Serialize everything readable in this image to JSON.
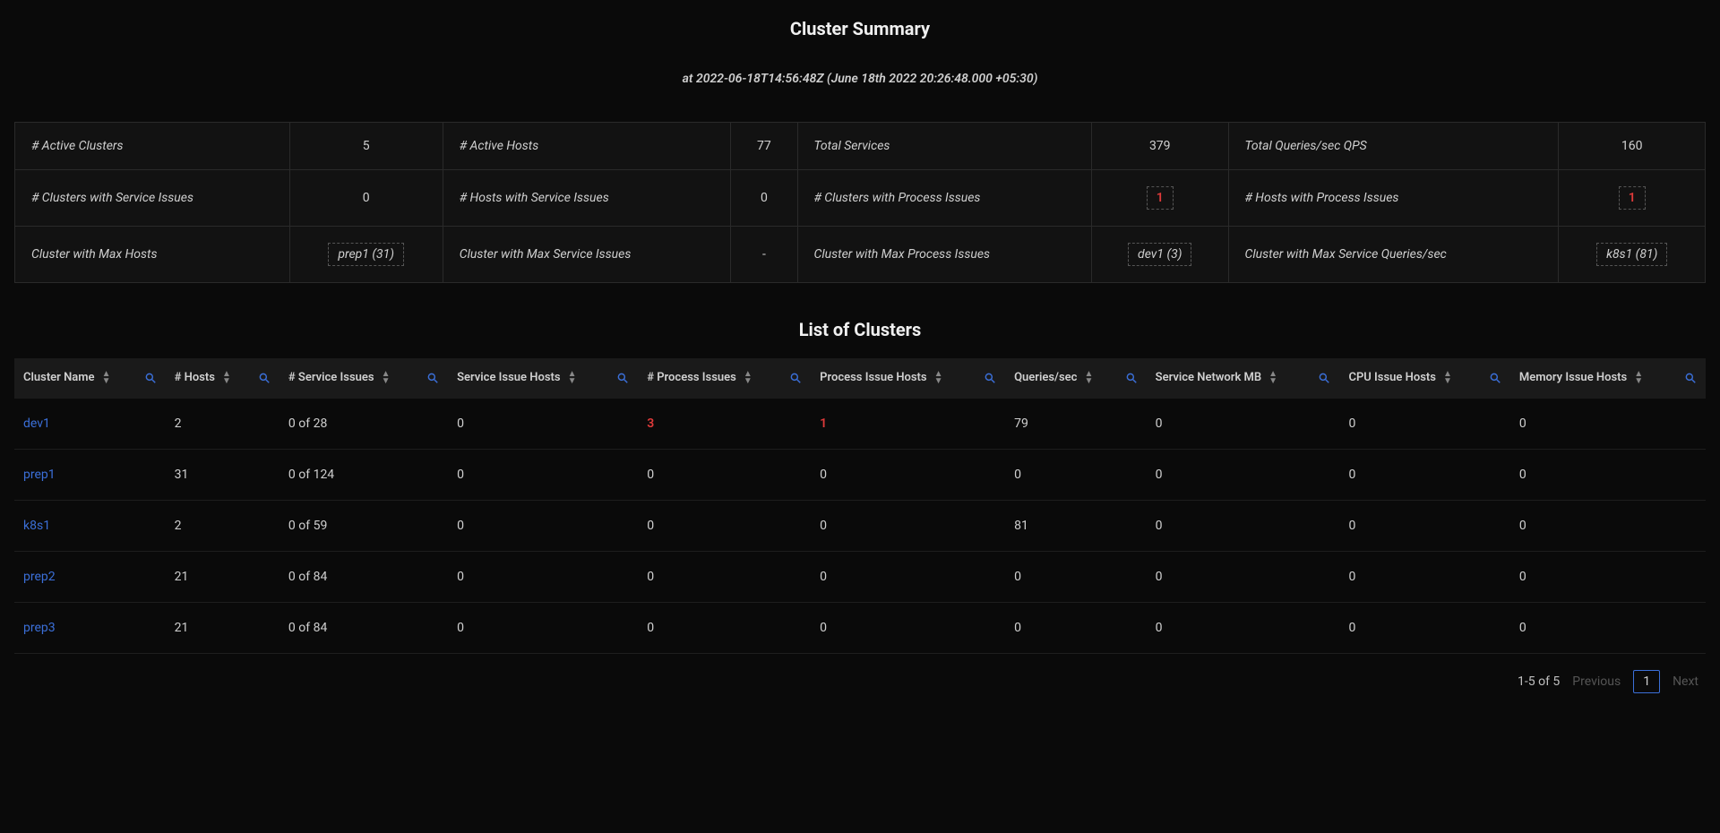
{
  "header": {
    "title": "Cluster Summary",
    "timestamp": "at 2022-06-18T14:56:48Z (June 18th 2022 20:26:48.000 +05:30)"
  },
  "summary": {
    "row1": {
      "activeClustersLabel": "# Active Clusters",
      "activeClustersValue": "5",
      "activeHostsLabel": "# Active Hosts",
      "activeHostsValue": "77",
      "totalServicesLabel": "Total Services",
      "totalServicesValue": "379",
      "totalQpsLabel": "Total Queries/sec QPS",
      "totalQpsValue": "160"
    },
    "row2": {
      "clustersServiceIssuesLabel": "# Clusters with Service Issues",
      "clustersServiceIssuesValue": "0",
      "hostsServiceIssuesLabel": "# Hosts with Service Issues",
      "hostsServiceIssuesValue": "0",
      "clustersProcessIssuesLabel": "# Clusters with Process Issues",
      "clustersProcessIssuesValue": "1",
      "hostsProcessIssuesLabel": "# Hosts with Process Issues",
      "hostsProcessIssuesValue": "1"
    },
    "row3": {
      "maxHostsLabel": "Cluster with Max Hosts",
      "maxHostsValue": "prep1 (31)",
      "maxServiceIssuesLabel": "Cluster with Max Service Issues",
      "maxServiceIssuesValue": "-",
      "maxProcessIssuesLabel": "Cluster with Max Process Issues",
      "maxProcessIssuesValue": "dev1 (3)",
      "maxServiceQpsLabel": "Cluster with Max Service Queries/sec",
      "maxServiceQpsValue": "k8s1 (81)"
    }
  },
  "listTitle": "List of Clusters",
  "columns": {
    "c0": "Cluster Name",
    "c1": "# Hosts",
    "c2": "# Service Issues",
    "c3": "Service Issue Hosts",
    "c4": "# Process Issues",
    "c5": "Process Issue Hosts",
    "c6": "Queries/sec",
    "c7": "Service Network MB",
    "c8": "CPU Issue Hosts",
    "c9": "Memory Issue Hosts"
  },
  "rows": [
    {
      "name": "dev1",
      "hosts": "2",
      "serviceIssues": "0 of 28",
      "serviceIssueHosts": "0",
      "processIssues": "3",
      "processIssueHosts": "1",
      "qps": "79",
      "netMB": "0",
      "cpu": "0",
      "mem": "0",
      "alert": true
    },
    {
      "name": "prep1",
      "hosts": "31",
      "serviceIssues": "0 of 124",
      "serviceIssueHosts": "0",
      "processIssues": "0",
      "processIssueHosts": "0",
      "qps": "0",
      "netMB": "0",
      "cpu": "0",
      "mem": "0",
      "alert": false
    },
    {
      "name": "k8s1",
      "hosts": "2",
      "serviceIssues": "0 of 59",
      "serviceIssueHosts": "0",
      "processIssues": "0",
      "processIssueHosts": "0",
      "qps": "81",
      "netMB": "0",
      "cpu": "0",
      "mem": "0",
      "alert": false
    },
    {
      "name": "prep2",
      "hosts": "21",
      "serviceIssues": "0 of 84",
      "serviceIssueHosts": "0",
      "processIssues": "0",
      "processIssueHosts": "0",
      "qps": "0",
      "netMB": "0",
      "cpu": "0",
      "mem": "0",
      "alert": false
    },
    {
      "name": "prep3",
      "hosts": "21",
      "serviceIssues": "0 of 84",
      "serviceIssueHosts": "0",
      "processIssues": "0",
      "processIssueHosts": "0",
      "qps": "0",
      "netMB": "0",
      "cpu": "0",
      "mem": "0",
      "alert": false
    }
  ],
  "pagination": {
    "range": "1-5 of 5",
    "prev": "Previous",
    "page": "1",
    "next": "Next"
  }
}
